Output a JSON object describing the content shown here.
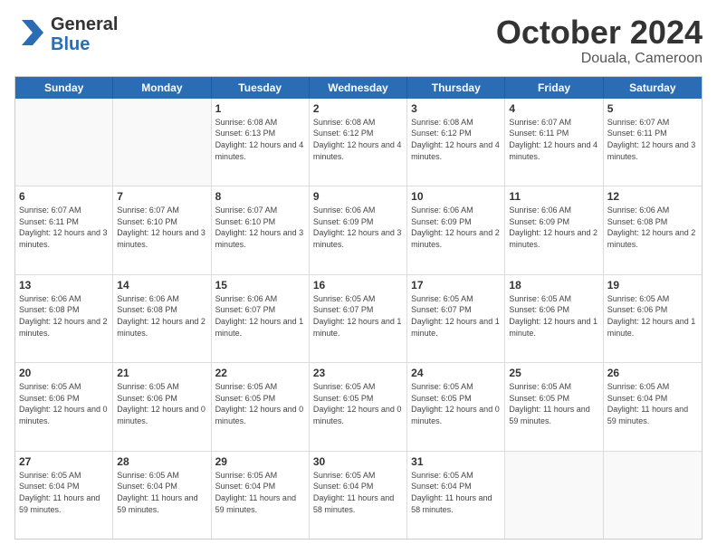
{
  "header": {
    "logo_line1": "General",
    "logo_line2": "Blue",
    "month": "October 2024",
    "location": "Douala, Cameroon"
  },
  "weekdays": [
    "Sunday",
    "Monday",
    "Tuesday",
    "Wednesday",
    "Thursday",
    "Friday",
    "Saturday"
  ],
  "rows": [
    [
      {
        "day": "",
        "info": ""
      },
      {
        "day": "",
        "info": ""
      },
      {
        "day": "1",
        "info": "Sunrise: 6:08 AM\nSunset: 6:13 PM\nDaylight: 12 hours\nand 4 minutes."
      },
      {
        "day": "2",
        "info": "Sunrise: 6:08 AM\nSunset: 6:12 PM\nDaylight: 12 hours\nand 4 minutes."
      },
      {
        "day": "3",
        "info": "Sunrise: 6:08 AM\nSunset: 6:12 PM\nDaylight: 12 hours\nand 4 minutes."
      },
      {
        "day": "4",
        "info": "Sunrise: 6:07 AM\nSunset: 6:11 PM\nDaylight: 12 hours\nand 4 minutes."
      },
      {
        "day": "5",
        "info": "Sunrise: 6:07 AM\nSunset: 6:11 PM\nDaylight: 12 hours\nand 3 minutes."
      }
    ],
    [
      {
        "day": "6",
        "info": "Sunrise: 6:07 AM\nSunset: 6:11 PM\nDaylight: 12 hours\nand 3 minutes."
      },
      {
        "day": "7",
        "info": "Sunrise: 6:07 AM\nSunset: 6:10 PM\nDaylight: 12 hours\nand 3 minutes."
      },
      {
        "day": "8",
        "info": "Sunrise: 6:07 AM\nSunset: 6:10 PM\nDaylight: 12 hours\nand 3 minutes."
      },
      {
        "day": "9",
        "info": "Sunrise: 6:06 AM\nSunset: 6:09 PM\nDaylight: 12 hours\nand 3 minutes."
      },
      {
        "day": "10",
        "info": "Sunrise: 6:06 AM\nSunset: 6:09 PM\nDaylight: 12 hours\nand 2 minutes."
      },
      {
        "day": "11",
        "info": "Sunrise: 6:06 AM\nSunset: 6:09 PM\nDaylight: 12 hours\nand 2 minutes."
      },
      {
        "day": "12",
        "info": "Sunrise: 6:06 AM\nSunset: 6:08 PM\nDaylight: 12 hours\nand 2 minutes."
      }
    ],
    [
      {
        "day": "13",
        "info": "Sunrise: 6:06 AM\nSunset: 6:08 PM\nDaylight: 12 hours\nand 2 minutes."
      },
      {
        "day": "14",
        "info": "Sunrise: 6:06 AM\nSunset: 6:08 PM\nDaylight: 12 hours\nand 2 minutes."
      },
      {
        "day": "15",
        "info": "Sunrise: 6:06 AM\nSunset: 6:07 PM\nDaylight: 12 hours\nand 1 minute."
      },
      {
        "day": "16",
        "info": "Sunrise: 6:05 AM\nSunset: 6:07 PM\nDaylight: 12 hours\nand 1 minute."
      },
      {
        "day": "17",
        "info": "Sunrise: 6:05 AM\nSunset: 6:07 PM\nDaylight: 12 hours\nand 1 minute."
      },
      {
        "day": "18",
        "info": "Sunrise: 6:05 AM\nSunset: 6:06 PM\nDaylight: 12 hours\nand 1 minute."
      },
      {
        "day": "19",
        "info": "Sunrise: 6:05 AM\nSunset: 6:06 PM\nDaylight: 12 hours\nand 1 minute."
      }
    ],
    [
      {
        "day": "20",
        "info": "Sunrise: 6:05 AM\nSunset: 6:06 PM\nDaylight: 12 hours\nand 0 minutes."
      },
      {
        "day": "21",
        "info": "Sunrise: 6:05 AM\nSunset: 6:06 PM\nDaylight: 12 hours\nand 0 minutes."
      },
      {
        "day": "22",
        "info": "Sunrise: 6:05 AM\nSunset: 6:05 PM\nDaylight: 12 hours\nand 0 minutes."
      },
      {
        "day": "23",
        "info": "Sunrise: 6:05 AM\nSunset: 6:05 PM\nDaylight: 12 hours\nand 0 minutes."
      },
      {
        "day": "24",
        "info": "Sunrise: 6:05 AM\nSunset: 6:05 PM\nDaylight: 12 hours\nand 0 minutes."
      },
      {
        "day": "25",
        "info": "Sunrise: 6:05 AM\nSunset: 6:05 PM\nDaylight: 11 hours\nand 59 minutes."
      },
      {
        "day": "26",
        "info": "Sunrise: 6:05 AM\nSunset: 6:04 PM\nDaylight: 11 hours\nand 59 minutes."
      }
    ],
    [
      {
        "day": "27",
        "info": "Sunrise: 6:05 AM\nSunset: 6:04 PM\nDaylight: 11 hours\nand 59 minutes."
      },
      {
        "day": "28",
        "info": "Sunrise: 6:05 AM\nSunset: 6:04 PM\nDaylight: 11 hours\nand 59 minutes."
      },
      {
        "day": "29",
        "info": "Sunrise: 6:05 AM\nSunset: 6:04 PM\nDaylight: 11 hours\nand 59 minutes."
      },
      {
        "day": "30",
        "info": "Sunrise: 6:05 AM\nSunset: 6:04 PM\nDaylight: 11 hours\nand 58 minutes."
      },
      {
        "day": "31",
        "info": "Sunrise: 6:05 AM\nSunset: 6:04 PM\nDaylight: 11 hours\nand 58 minutes."
      },
      {
        "day": "",
        "info": ""
      },
      {
        "day": "",
        "info": ""
      }
    ]
  ]
}
